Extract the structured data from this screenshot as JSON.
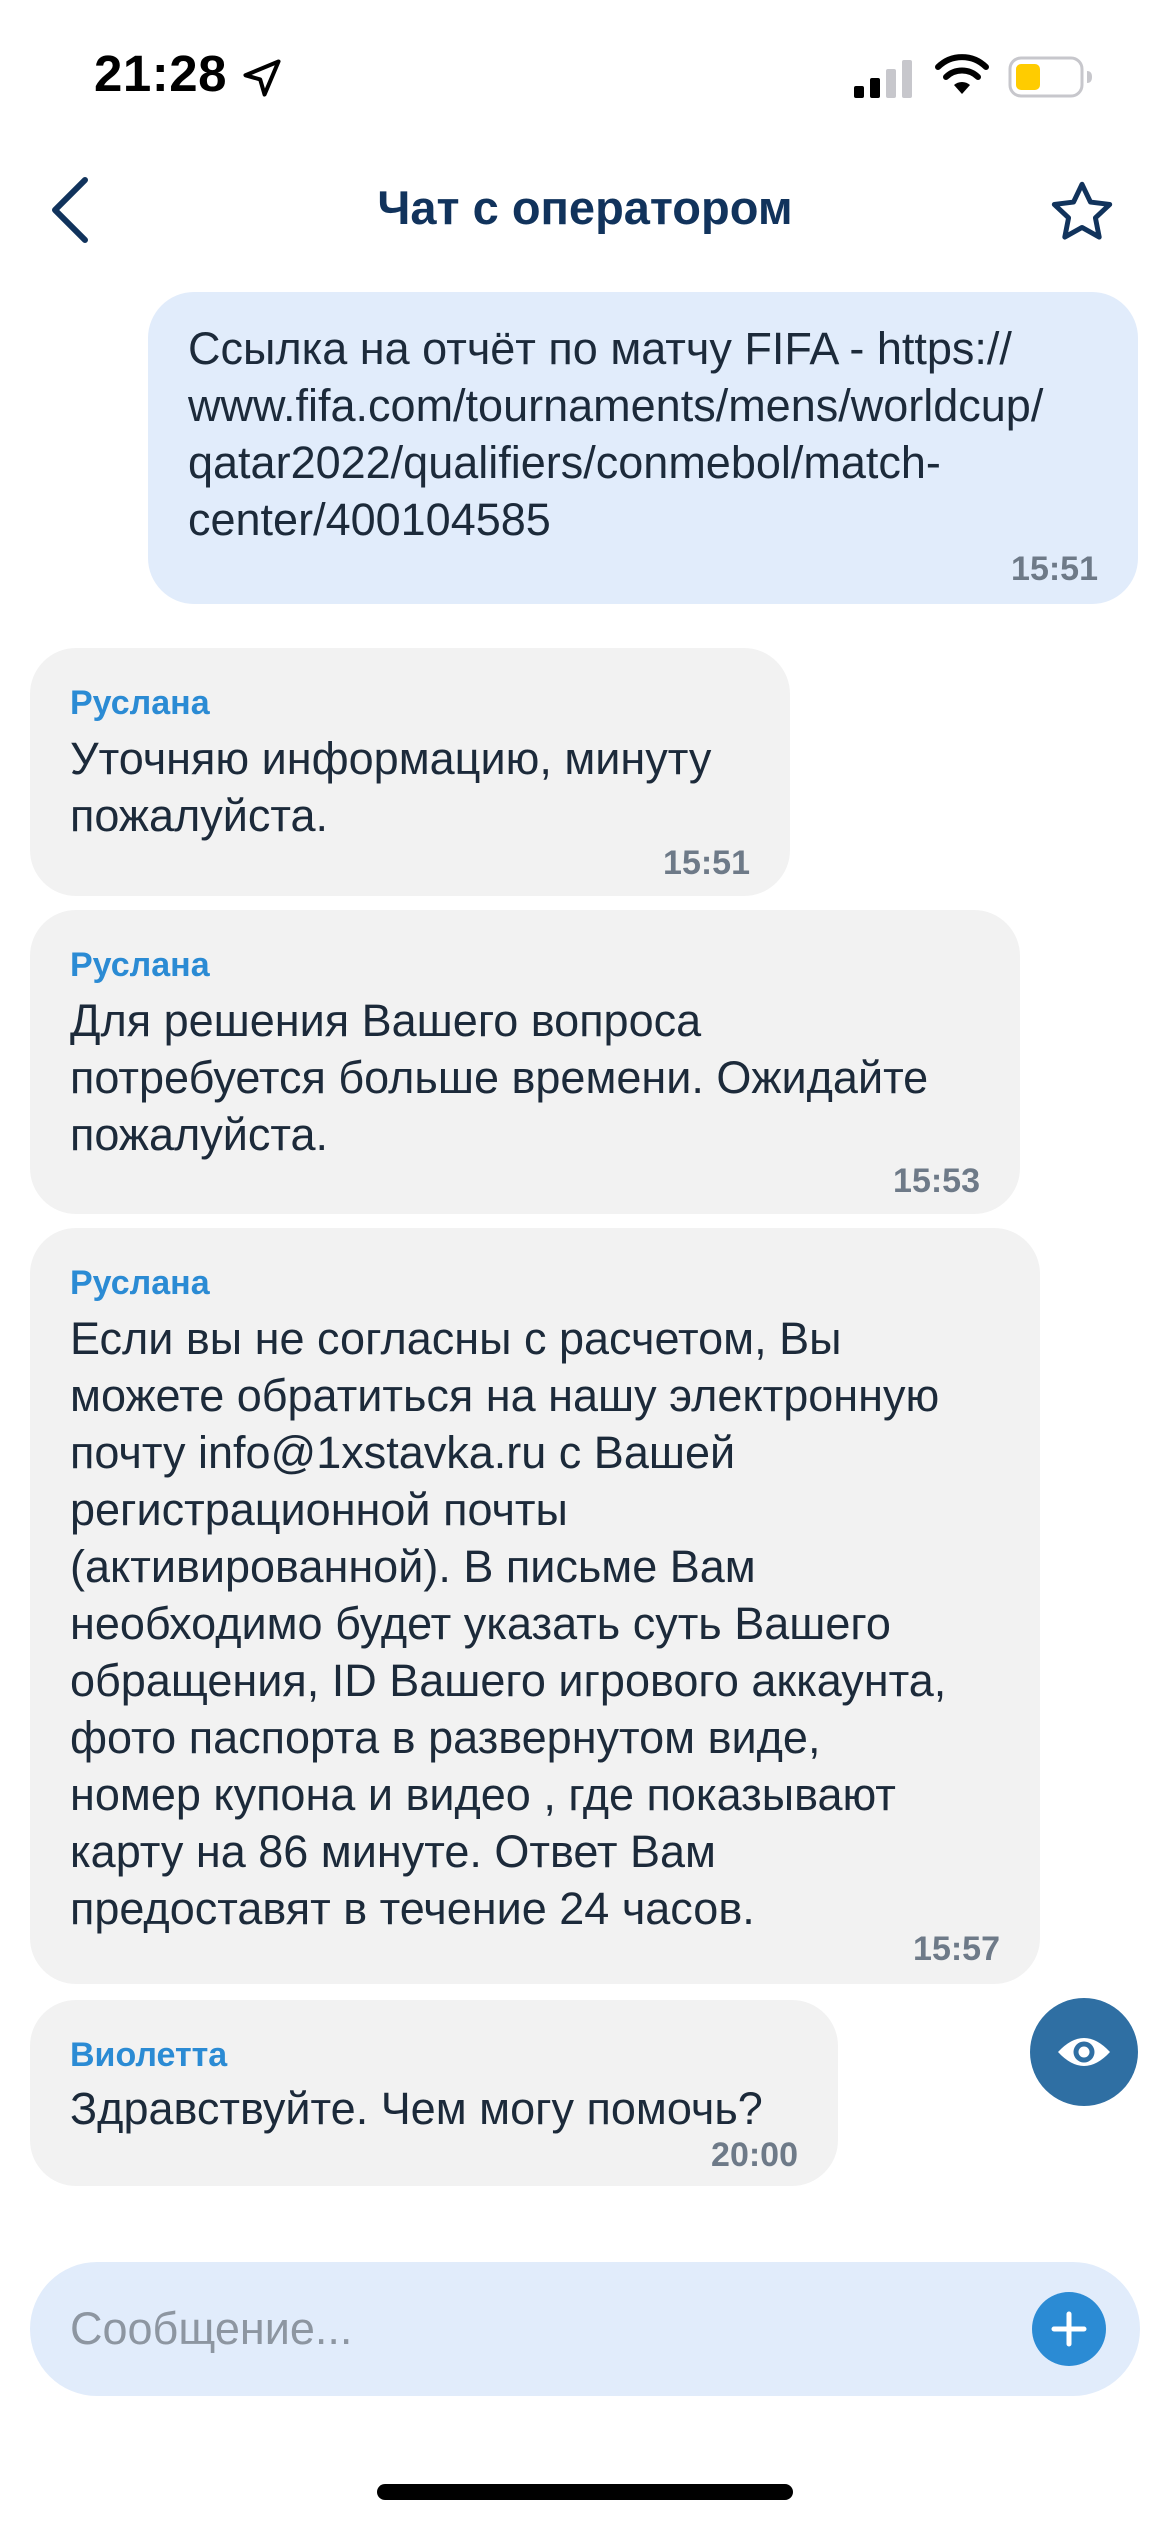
{
  "status_bar": {
    "time": "21:28",
    "battery_color": "#ffcc00"
  },
  "header": {
    "title": "Чат с оператором",
    "back_icon": "chevron-left-icon",
    "favorite_icon": "star-outline-icon"
  },
  "messages": [
    {
      "direction": "out",
      "text": "Ссылка на отчёт по матчу FIFA - https://\nwww.fifa.com/tournaments/mens/worldcup/\nqatar2022/qualifiers/conmebol/match-\ncenter/400104585",
      "time": "15:51"
    },
    {
      "direction": "in",
      "author": "Руслана",
      "text": "Уточняю информацию, минуту\nпожалуйста.",
      "time": "15:51"
    },
    {
      "direction": "in",
      "author": "Руслана",
      "text": "Для решения Вашего вопроса\nпотребуется больше времени. Ожидайте\nпожалуйста.",
      "time": "15:53"
    },
    {
      "direction": "in",
      "author": "Руслана",
      "text": "Если вы не согласны с расчетом, Вы\nможете обратиться на нашу электронную\nпочту info@1xstavka.ru с Вашей\nрегистрационной почты\n(активированной). В письме Вам\nнеобходимо будет указать суть Вашего\nобращения, ID Вашего игрового аккаунта,\nфото паспорта в развернутом виде,\nномер купона и видео , где показывают\nкарту на 86 минуте. Ответ Вам\nпредоставят в течение 24 часов.",
      "time": "15:57"
    },
    {
      "direction": "in",
      "author": "Виолетта",
      "text": "Здравствуйте. Чем могу помочь?",
      "time": "20:00"
    }
  ],
  "composer": {
    "placeholder": "Сообщение...",
    "value": "",
    "add_icon": "plus-icon"
  },
  "floating": {
    "icon": "eye-icon"
  },
  "colors": {
    "title": "#11335c",
    "author": "#2b8bd4",
    "outgoing_bubble": "#e1ecfb",
    "incoming_bubble": "#f2f2f2",
    "eye_button": "#2f6fa3",
    "add_button": "#2b8bd4"
  }
}
